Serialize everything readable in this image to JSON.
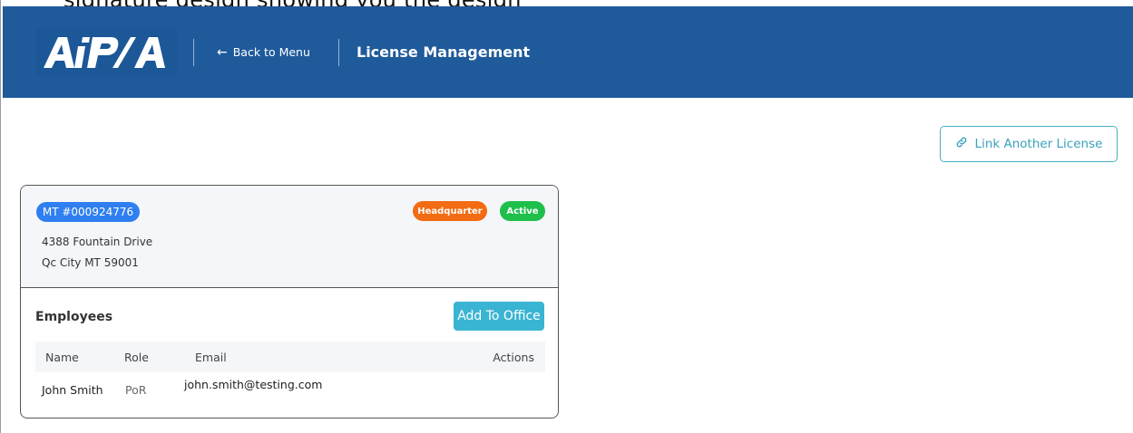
{
  "header": {
    "logo_text": "AiPSA",
    "back_label": "Back to Menu",
    "title": "License Management"
  },
  "toolbar": {
    "link_label": "Link Another License"
  },
  "license_card": {
    "license_badge": "MT #000924776",
    "hq_badge": "Headquarter",
    "status_badge": "Active",
    "address_line1": "4388 Fountain Drive",
    "address_line2": "Qc City MT 59001",
    "employees_title": "Employees",
    "add_button_label": "Add To Office",
    "columns": {
      "name": "Name",
      "role": "Role",
      "email": "Email",
      "actions": "Actions"
    },
    "rows": [
      {
        "name": "John Smith",
        "role": "PoR",
        "email": "john.smith@testing.com"
      }
    ]
  },
  "colors": {
    "header_bg": "#1f5a9b",
    "accent_teal": "#3ab4d3",
    "license_blue": "#2f7ff0",
    "hq_orange": "#f36b12",
    "active_green": "#1fbf4b"
  }
}
